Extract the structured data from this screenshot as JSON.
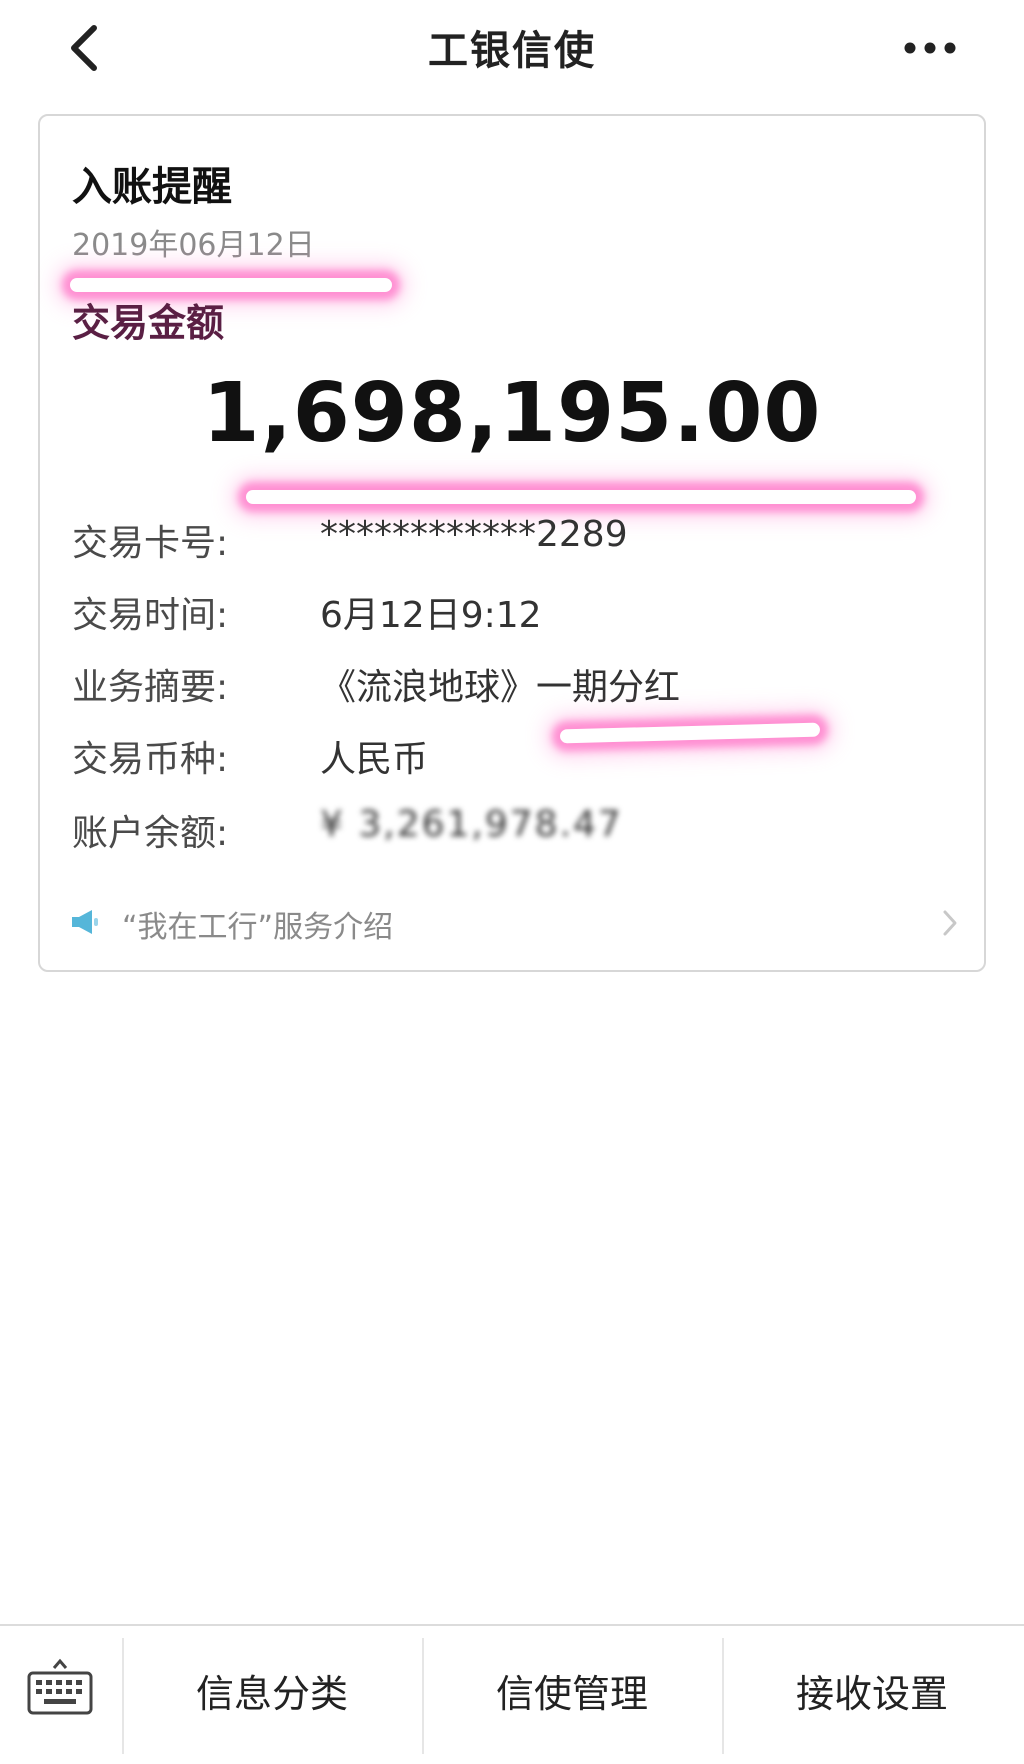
{
  "header": {
    "title": "工银信使",
    "back_icon": "chevron-left-icon",
    "more_icon": "more-horizontal-icon"
  },
  "card": {
    "title": "入账提醒",
    "date": "2019年06月12日",
    "amount_label": "交易金额",
    "amount": "1,698,195.00",
    "fields": [
      {
        "label": "交易卡号:",
        "value": "************2289"
      },
      {
        "label": "交易时间:",
        "value": "6月12日9:12"
      },
      {
        "label": "业务摘要:",
        "value": "《流浪地球》一期分红"
      },
      {
        "label": "交易币种:",
        "value": "人民币"
      },
      {
        "label": "账户余额:",
        "value": "¥ 3,261,978.47"
      }
    ],
    "service_link": "“我在工行”服务介绍",
    "highlight_color": "#ff7ac8"
  },
  "bottom_bar": {
    "keyboard_icon": "keyboard-icon",
    "tabs": [
      "信息分类",
      "信使管理",
      "接收设置"
    ]
  }
}
